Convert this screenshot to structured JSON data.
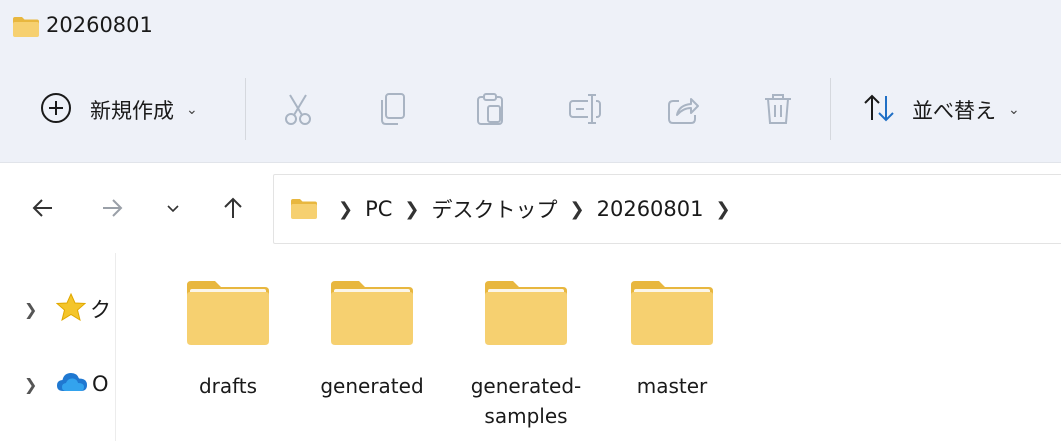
{
  "window": {
    "title": "20260801"
  },
  "toolbar": {
    "new_label": "新規作成",
    "sort_label": "並べ替え",
    "icons": [
      "add-circle-icon",
      "cut-icon",
      "copy-icon",
      "paste-icon",
      "rename-icon",
      "share-icon",
      "delete-icon",
      "sort-icon"
    ]
  },
  "address": {
    "crumbs": [
      "PC",
      "デスクトップ",
      "20260801"
    ]
  },
  "sidebar": {
    "items": [
      {
        "label": "ク"
      },
      {
        "label": "O"
      }
    ]
  },
  "folders": [
    {
      "name": "drafts"
    },
    {
      "name": "generated"
    },
    {
      "name": "generated-samples"
    },
    {
      "name": "master"
    }
  ],
  "colors": {
    "accent": "#1f6fc5",
    "folder": "#f6d070",
    "folder_dark": "#e8b73f",
    "disabled_icon": "#a9b4c3"
  }
}
